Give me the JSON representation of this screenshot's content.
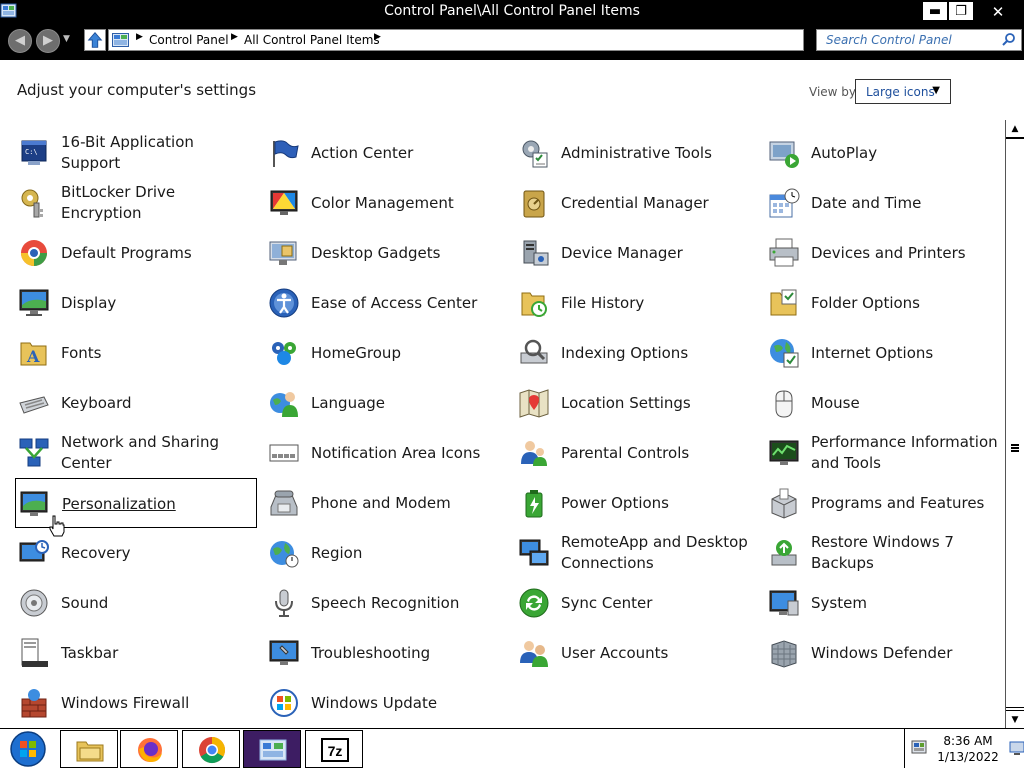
{
  "window": {
    "title": "Control Panel\\All Control Panel Items",
    "minimize": "▬",
    "maximize": "❐",
    "close": "✕"
  },
  "nav": {
    "breadcrumbs": [
      "Control Panel",
      "All Control Panel Items"
    ],
    "search_placeholder": "Search Control Panel"
  },
  "header": {
    "title": "Adjust your computer's settings",
    "view_by_label": "View by:",
    "view_by_value": "Large icons"
  },
  "items": [
    {
      "label": "16-Bit Application Support",
      "icon": "dos-window-icon"
    },
    {
      "label": "Action Center",
      "icon": "flag-icon"
    },
    {
      "label": "Administrative Tools",
      "icon": "admin-tools-icon"
    },
    {
      "label": "AutoPlay",
      "icon": "autoplay-icon"
    },
    {
      "label": "BitLocker Drive Encryption",
      "icon": "bitlocker-key-icon"
    },
    {
      "label": "Color Management",
      "icon": "color-monitor-icon"
    },
    {
      "label": "Credential Manager",
      "icon": "vault-icon"
    },
    {
      "label": "Date and Time",
      "icon": "calendar-clock-icon"
    },
    {
      "label": "Default Programs",
      "icon": "default-programs-icon"
    },
    {
      "label": "Desktop Gadgets",
      "icon": "gadgets-icon"
    },
    {
      "label": "Device Manager",
      "icon": "device-manager-icon"
    },
    {
      "label": "Devices and Printers",
      "icon": "printer-icon"
    },
    {
      "label": "Display",
      "icon": "display-monitor-icon"
    },
    {
      "label": "Ease of Access Center",
      "icon": "ease-of-access-icon"
    },
    {
      "label": "File History",
      "icon": "file-history-icon"
    },
    {
      "label": "Folder Options",
      "icon": "folder-options-icon"
    },
    {
      "label": "Fonts",
      "icon": "fonts-folder-icon"
    },
    {
      "label": "HomeGroup",
      "icon": "homegroup-icon"
    },
    {
      "label": "Indexing Options",
      "icon": "indexing-icon"
    },
    {
      "label": "Internet Options",
      "icon": "internet-globe-icon"
    },
    {
      "label": "Keyboard",
      "icon": "keyboard-icon"
    },
    {
      "label": "Language",
      "icon": "language-icon"
    },
    {
      "label": "Location Settings",
      "icon": "location-map-icon"
    },
    {
      "label": "Mouse",
      "icon": "mouse-icon"
    },
    {
      "label": "Network and Sharing Center",
      "icon": "network-icon"
    },
    {
      "label": "Notification Area Icons",
      "icon": "notification-area-icon"
    },
    {
      "label": "Parental Controls",
      "icon": "parental-controls-icon"
    },
    {
      "label": "Performance Information and Tools",
      "icon": "performance-icon"
    },
    {
      "label": "Personalization",
      "icon": "personalization-icon"
    },
    {
      "label": "Phone and Modem",
      "icon": "phone-modem-icon"
    },
    {
      "label": "Power Options",
      "icon": "battery-icon"
    },
    {
      "label": "Programs and Features",
      "icon": "programs-box-icon"
    },
    {
      "label": "Recovery",
      "icon": "recovery-icon"
    },
    {
      "label": "Region",
      "icon": "region-globe-icon"
    },
    {
      "label": "RemoteApp and Desktop Connections",
      "icon": "remote-desktop-icon"
    },
    {
      "label": "Restore Windows 7 Backups",
      "icon": "backup-restore-icon"
    },
    {
      "label": "Sound",
      "icon": "speaker-icon"
    },
    {
      "label": "Speech Recognition",
      "icon": "microphone-icon"
    },
    {
      "label": "Sync Center",
      "icon": "sync-icon"
    },
    {
      "label": "System",
      "icon": "system-icon"
    },
    {
      "label": "Taskbar",
      "icon": "taskbar-icon"
    },
    {
      "label": "Troubleshooting",
      "icon": "troubleshooting-icon"
    },
    {
      "label": "User Accounts",
      "icon": "user-accounts-icon"
    },
    {
      "label": "Windows Defender",
      "icon": "windows-defender-icon"
    },
    {
      "label": "Windows Firewall",
      "icon": "firewall-icon"
    },
    {
      "label": "Windows Update",
      "icon": "windows-update-icon"
    }
  ],
  "selected_item": "Personalization",
  "taskbar": {
    "apps": [
      "file-explorer-icon",
      "firefox-icon",
      "chrome-icon",
      "control-panel-icon",
      "7zip-icon"
    ],
    "active_app": "control-panel-icon",
    "zip_label": "7z",
    "time": "8:36 AM",
    "date": "1/13/2022"
  }
}
